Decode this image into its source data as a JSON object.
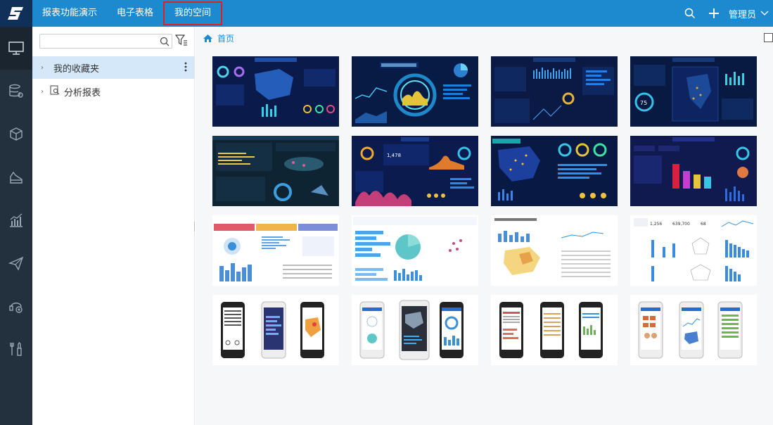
{
  "nav": {
    "items": [
      {
        "label": "报表功能演示"
      },
      {
        "label": "电子表格"
      },
      {
        "label": "我的空间"
      }
    ],
    "active_index": 2
  },
  "user": {
    "name": "管理员"
  },
  "sidebar_icons": [
    "desktop-icon",
    "database-settings-icon",
    "cubes-icon",
    "ruler-icon",
    "bar-chart-icon",
    "send-icon",
    "user-support-icon",
    "tools-icon"
  ],
  "search": {
    "placeholder": "",
    "value": ""
  },
  "tree": [
    {
      "label": "我的收藏夹",
      "selected": true
    },
    {
      "label": "分析报表",
      "selected": false
    }
  ],
  "breadcrumb": {
    "label": "首页"
  },
  "thumbnails": {
    "rows": [
      [
        "dark-dashboard",
        "dark-dashboard",
        "dark-dashboard",
        "dark-dashboard"
      ],
      [
        "dark-dashboard",
        "dark-dashboard",
        "dark-dashboard",
        "dark-dashboard"
      ],
      [
        "light-dashboard",
        "light-dashboard",
        "light-dashboard",
        "light-dashboard"
      ],
      [
        "mobile-preview",
        "mobile-preview",
        "mobile-preview",
        "mobile-preview"
      ]
    ]
  },
  "colors": {
    "topbar": "#1d8ad0",
    "logo_bg": "#10305a",
    "leftbar": "#23303d",
    "selected_row": "#d5e8fa",
    "active_outline": "#e02020"
  }
}
